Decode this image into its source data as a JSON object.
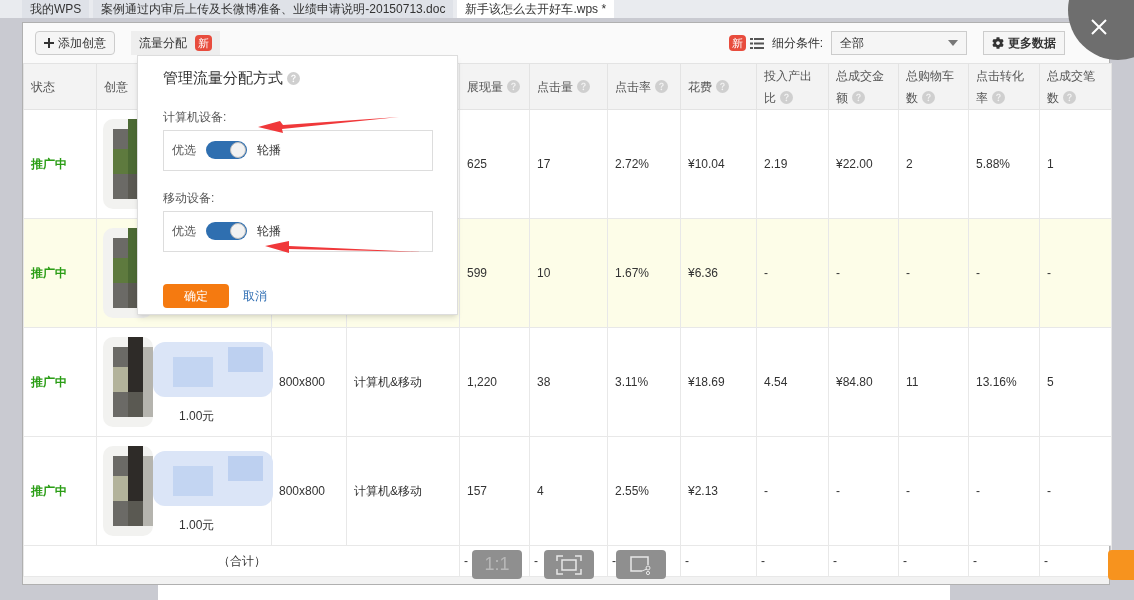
{
  "browser_tabs": [
    {
      "label": "我的WPS",
      "selected": false
    },
    {
      "label": "案例通过内审后上传及长微博准备、业绩申请说明-20150713.doc",
      "selected": false
    },
    {
      "label": "新手该怎么去开好车.wps *",
      "selected": true
    }
  ],
  "toolbar": {
    "add_button": "添加创意",
    "traffic_button": {
      "label": "流量分配",
      "badge": "新"
    },
    "badge": "新",
    "filter_label": "细分条件:",
    "filter_value": "全部",
    "more_button": "更多数据"
  },
  "table": {
    "columns": [
      {
        "label": "状态",
        "help": false
      },
      {
        "label": "创意",
        "help": false
      },
      {
        "label": "展现量",
        "help": true
      },
      {
        "label": "点击量",
        "help": true
      },
      {
        "label": "点击率",
        "help": true
      },
      {
        "label": "花费",
        "help": true
      },
      {
        "label": "投入产出比",
        "help": true
      },
      {
        "label": "总成交金额",
        "help": true
      },
      {
        "label": "总购物车数",
        "help": true
      },
      {
        "label": "点击转化率",
        "help": true
      },
      {
        "label": "总成交笔数",
        "help": true
      }
    ],
    "rows": [
      {
        "status": "推广中",
        "selected": false,
        "metrics": [
          "625",
          "17",
          "2.72%",
          "¥10.04",
          "2.19",
          "¥22.00",
          "2",
          "5.88%",
          "1"
        ]
      },
      {
        "status": "推广中",
        "selected": true,
        "metrics": [
          "599",
          "10",
          "1.67%",
          "¥6.36",
          "-",
          "-",
          "-",
          "-",
          "-"
        ]
      },
      {
        "status": "推广中",
        "selected": false,
        "creative": {
          "kind": "picture",
          "price": "1.00元"
        },
        "size": "800x800",
        "device": "计算机&移动",
        "metrics": [
          "1,220",
          "38",
          "3.11%",
          "¥18.69",
          "4.54",
          "¥84.80",
          "11",
          "13.16%",
          "5"
        ]
      },
      {
        "status": "推广中",
        "selected": false,
        "creative": {
          "kind": "picture",
          "price": "1.00元"
        },
        "size": "800x800",
        "device": "计算机&移动",
        "metrics": [
          "157",
          "4",
          "2.55%",
          "¥2.13",
          "-",
          "-",
          "-",
          "-",
          "-"
        ]
      }
    ],
    "total": {
      "label": "（合计）",
      "metrics": [
        "-",
        "-",
        "-",
        "-",
        "-",
        "-",
        "-",
        "-",
        "-"
      ]
    }
  },
  "popover": {
    "title": "管理流量分配方式",
    "sections": [
      {
        "label": "计算机设备:",
        "left": "优选",
        "right": "轮播",
        "on": true
      },
      {
        "label": "移动设备:",
        "left": "优选",
        "right": "轮播",
        "on": true
      }
    ],
    "confirm": "确定",
    "cancel": "取消"
  },
  "viewer_controls": {
    "actual_size": "1:1"
  }
}
